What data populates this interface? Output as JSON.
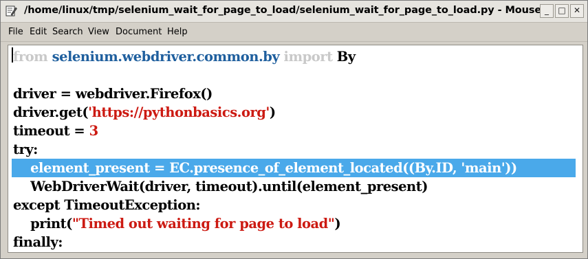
{
  "window": {
    "title": "/home/linux/tmp/selenium_wait_for_page_to_load/selenium_wait_for_page_to_load.py - Mousepa",
    "icon": "edit-icon",
    "buttons": {
      "minimize": "_",
      "maximize": "□",
      "close": "✕"
    }
  },
  "menu": {
    "items": [
      "File",
      "Edit",
      "Search",
      "View",
      "Document",
      "Help"
    ]
  },
  "editor": {
    "line1": {
      "kw_from": "from",
      "module": "selenium.webdriver.common.by",
      "kw_import": "import",
      "name": "By"
    },
    "line3": "driver = webdriver.Firefox()",
    "line4": {
      "pre": "driver.get(",
      "str": "'https://pythonbasics.org'",
      "post": ")"
    },
    "line5": {
      "pre": "timeout = ",
      "num": "3"
    },
    "line6": "try:",
    "line7": "    element_present = EC.presence_of_element_located((By.ID, 'main'))",
    "line8": "    WebDriverWait(driver, timeout).until(element_present)",
    "line9": "except TimeoutException:",
    "line10": {
      "pre": "    print(",
      "str": "\"Timed out waiting for page to load\"",
      "post": ")"
    },
    "line11": "finally:",
    "selected_line": 7
  },
  "colors": {
    "keyword": "#c9c9c9",
    "module": "#1f5f9e",
    "string": "#cc1a12",
    "selection": "#4aa9ea"
  }
}
